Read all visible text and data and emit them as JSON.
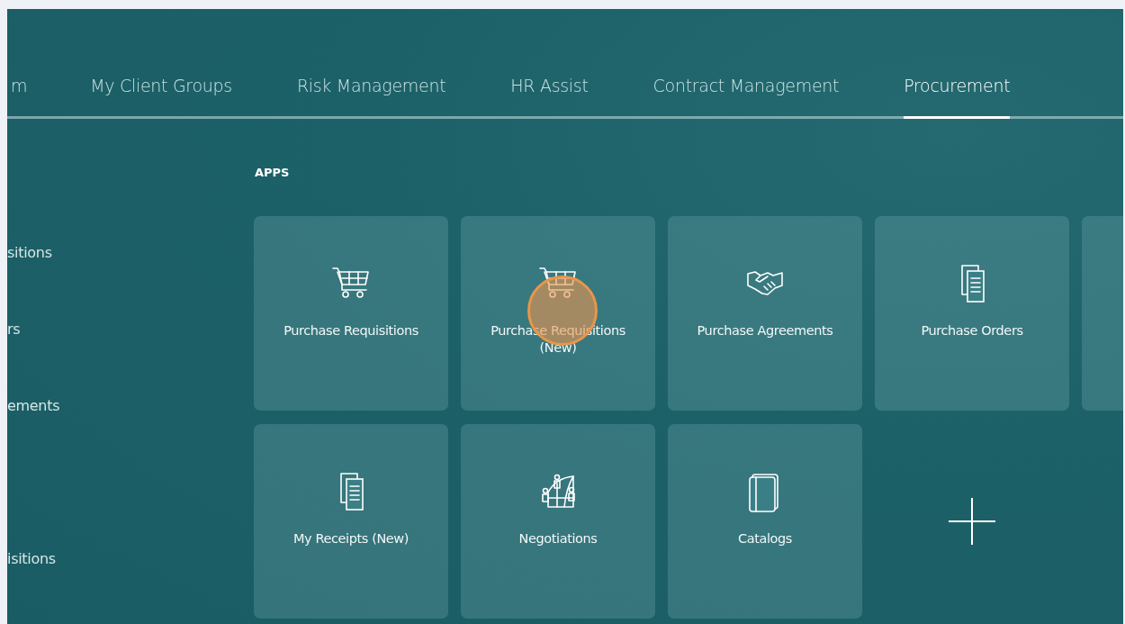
{
  "nav_tabs": [
    {
      "label": "m",
      "selected": false
    },
    {
      "label": "My Client Groups",
      "selected": false
    },
    {
      "label": "Risk Management",
      "selected": false
    },
    {
      "label": "HR Assist",
      "selected": false
    },
    {
      "label": "Contract Management",
      "selected": false
    },
    {
      "label": "Procurement",
      "selected": true
    }
  ],
  "sidebar": {
    "items": [
      "sitions",
      "rs",
      "ements",
      "isitions"
    ]
  },
  "apps": {
    "heading": "APPS",
    "tiles": [
      {
        "kind": "app",
        "label": "Purchase Requisitions",
        "clicked": false
      },
      {
        "kind": "app",
        "label": "Purchase Requisitions (New)",
        "clicked": true
      },
      {
        "kind": "app",
        "label": "Purchase Agreements",
        "clicked": false
      },
      {
        "kind": "app",
        "label": "Purchase Orders",
        "clicked": false
      },
      {
        "kind": "partial"
      },
      {
        "kind": "app",
        "label": "My Receipts (New)",
        "clicked": false
      },
      {
        "kind": "app",
        "label": "Negotiations",
        "clicked": false
      },
      {
        "kind": "app",
        "label": "Catalogs",
        "clicked": false
      },
      {
        "kind": "add"
      }
    ]
  }
}
